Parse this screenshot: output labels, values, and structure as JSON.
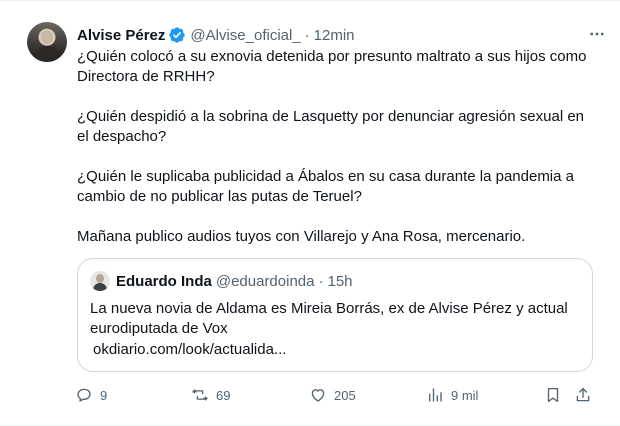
{
  "author": {
    "name": "Alvise Pérez",
    "handle": "@Alvise_oficial_",
    "separator": "·",
    "time": "12min"
  },
  "more_label": "···",
  "tweet_paragraphs": [
    "¿Quién colocó a su exnovia detenida por presunto maltrato a sus hijos como Directora de RRHH?",
    "¿Quién despidió a la sobrina de Lasquetty por denunciar agresión sexual en el despacho?",
    "¿Quién le suplicaba publicidad a Ábalos en su casa durante la pandemia a cambio de no publicar las putas de Teruel?",
    "Mañana publico audios tuyos con Villarejo y Ana Rosa, mercenario."
  ],
  "quote": {
    "name": "Eduardo Inda",
    "handle": "@eduardoinda",
    "separator": "·",
    "time": "15h",
    "text": "La nueva novia de Aldama es Mireia Borrás, ex de Alvise Pérez y actual eurodiputada de Vox",
    "link": "okdiario.com/look/actualida..."
  },
  "actions": {
    "replies": "9",
    "retweets": "69",
    "likes": "205",
    "views": "9 mil"
  },
  "icons": {
    "verified": "verified-badge-icon",
    "reply": "reply-icon",
    "retweet": "retweet-icon",
    "like": "heart-icon",
    "views": "views-chart-icon",
    "bookmark": "bookmark-icon",
    "share": "share-icon",
    "more": "more-icon"
  },
  "colors": {
    "text": "#0f1419",
    "secondary": "#536471",
    "verified": "#1d9bf0",
    "border": "#cfd9de"
  }
}
